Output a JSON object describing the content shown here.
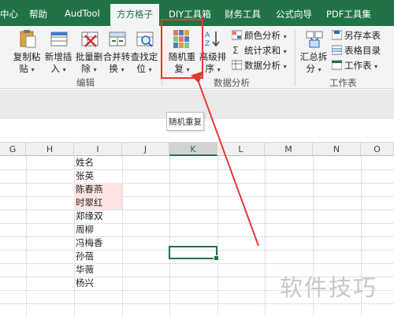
{
  "tabs": [
    {
      "label": "中心",
      "active": false
    },
    {
      "label": "帮助",
      "active": false
    },
    {
      "label": "AudTool",
      "active": false
    },
    {
      "label": "方方格子",
      "active": true
    },
    {
      "label": "DIY工具箱",
      "active": false
    },
    {
      "label": "财务工具",
      "active": false
    },
    {
      "label": "公式向导",
      "active": false
    },
    {
      "label": "PDF工具集",
      "active": false
    }
  ],
  "ribbon": {
    "copy_paste": {
      "line1": "复制粘",
      "line2": "贴"
    },
    "add_insert": {
      "line1": "新增插",
      "line2": "入"
    },
    "batch_delete": {
      "line1": "批量删",
      "line2": "除"
    },
    "merge_convert": {
      "line1": "合并转",
      "line2": "换"
    },
    "find_locate": {
      "line1": "查找定",
      "line2": "位"
    },
    "random_repeat": {
      "line1": "随机重",
      "line2": "复"
    },
    "advanced_sort": {
      "line1": "高级排",
      "line2": "序"
    },
    "color_analysis": "颜色分析",
    "stats_sum": "统计求和",
    "data_analysis_menu": "数据分析",
    "summarize_split": {
      "line1": "汇总拆",
      "line2": "分"
    },
    "save_as_sheet": "另存本表",
    "table_dir": "表格目录",
    "worksheet": "工作表",
    "group_edit": "编辑",
    "group_data": "数据分析",
    "group_sheet": "工作表"
  },
  "tooltip": "随机重复",
  "columns": [
    "G",
    "H",
    "I",
    "J",
    "K",
    "L",
    "M",
    "N",
    "O"
  ],
  "selected_column": "K",
  "cells": [
    {
      "text": "姓名",
      "highlight": false
    },
    {
      "text": "张英",
      "highlight": false
    },
    {
      "text": "陈春燕",
      "highlight": true
    },
    {
      "text": "时翠红",
      "highlight": true
    },
    {
      "text": "郑缘双",
      "highlight": false
    },
    {
      "text": "周柳",
      "highlight": false
    },
    {
      "text": "冯梅香",
      "highlight": false
    },
    {
      "text": "孙蓓",
      "highlight": false
    },
    {
      "text": "华薇",
      "highlight": false
    },
    {
      "text": "杨兴",
      "highlight": false
    }
  ],
  "watermark": "软件技巧",
  "colors": {
    "excel_green": "#217346",
    "highlight_red": "#e53935",
    "pink_fill": "#fde4e2"
  }
}
